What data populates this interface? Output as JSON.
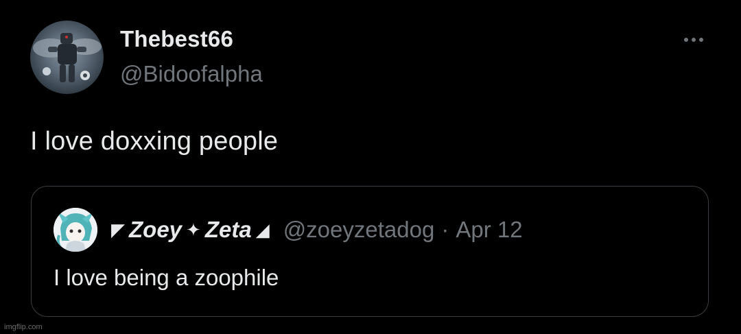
{
  "tweet": {
    "author": {
      "display_name": "Thebest66",
      "handle": "@Bidoofalpha",
      "avatar_icon": "robot-figure-avatar"
    },
    "more_icon": "more-dots-icon",
    "text": "I love doxxing people",
    "quote": {
      "author": {
        "name_prefix": "◤",
        "display_name_part1": "Zoey",
        "name_star": "✦",
        "display_name_part2": "Zeta",
        "name_suffix": "◢",
        "handle": "@zoeyzetadog",
        "avatar_icon": "anime-character-avatar"
      },
      "separator": "·",
      "date": "Apr 12",
      "text": "I love being a zoophile"
    }
  },
  "watermark": "imgflip.com",
  "colors": {
    "background": "#000000",
    "primary_text": "#e7e9ea",
    "secondary_text": "#71767b",
    "border": "#3a3d41"
  }
}
